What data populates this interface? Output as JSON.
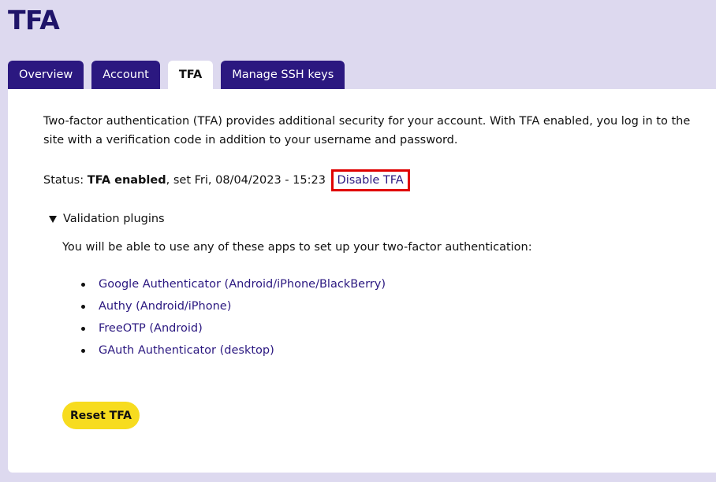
{
  "page": {
    "title": "TFA"
  },
  "tabs": [
    {
      "label": "Overview",
      "active": false
    },
    {
      "label": "Account",
      "active": false
    },
    {
      "label": "TFA",
      "active": true
    },
    {
      "label": "Manage SSH keys",
      "active": false
    }
  ],
  "content": {
    "intro": "Two-factor authentication (TFA) provides additional security for your account. With TFA enabled, you log in to the site with a verification code in addition to your username and password.",
    "status_label": "Status: ",
    "status_value": "TFA enabled",
    "status_suffix": ", set Fri, 08/04/2023 - 15:23",
    "disable_link": "Disable TFA",
    "details_summary": "Validation plugins",
    "apps_intro": "You will be able to use any of these apps to set up your two-factor authentication:",
    "apps": [
      "Google Authenticator (Android/iPhone/BlackBerry)",
      "Authy (Android/iPhone)",
      "FreeOTP (Android)",
      "GAuth Authenticator (desktop)"
    ],
    "reset_button": "Reset TFA"
  },
  "colors": {
    "background": "#ddd9ef",
    "brand": "#2b1880",
    "title": "#1f1469",
    "button": "#f7dc1f",
    "highlight": "#e00000"
  },
  "icons": {
    "details_toggle": "triangle-down-icon"
  }
}
